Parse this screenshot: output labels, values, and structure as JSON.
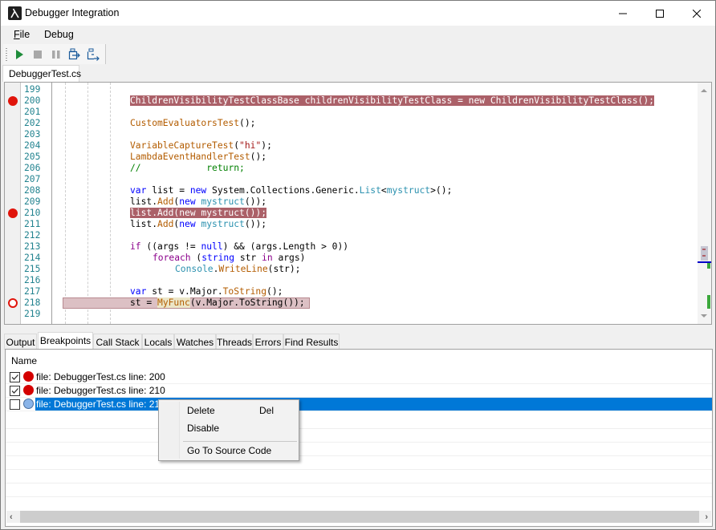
{
  "window": {
    "title": "Debugger Integration",
    "controls": {
      "minimize": "minimize",
      "maximize": "maximize",
      "close": "close"
    }
  },
  "menu": {
    "items": [
      {
        "label_underlined": "F",
        "label_rest": "ile"
      },
      {
        "label": "Debug"
      }
    ]
  },
  "toolbar": {
    "buttons": [
      "play",
      "stop",
      "pause",
      "step-into",
      "step-over"
    ]
  },
  "document_tab": {
    "label": "DebuggerTest.cs"
  },
  "editor": {
    "lines": [
      {
        "num": "199"
      },
      {
        "num": "200",
        "breakpoint": "enabled",
        "highlight": "active"
      },
      {
        "num": "201"
      },
      {
        "num": "202"
      },
      {
        "num": "203"
      },
      {
        "num": "204"
      },
      {
        "num": "205"
      },
      {
        "num": "206"
      },
      {
        "num": "207"
      },
      {
        "num": "208"
      },
      {
        "num": "209"
      },
      {
        "num": "210",
        "breakpoint": "enabled",
        "highlight": "active"
      },
      {
        "num": "211"
      },
      {
        "num": "212"
      },
      {
        "num": "213"
      },
      {
        "num": "214"
      },
      {
        "num": "215"
      },
      {
        "num": "216"
      },
      {
        "num": "217"
      },
      {
        "num": "218",
        "breakpoint": "disabled",
        "highlight": "disabled"
      },
      {
        "num": "219"
      }
    ],
    "code": {
      "l200": "ChildrenVisibilityTestClassBase childrenVisibilityTestClass = new ChildrenVisibilityTestClass();",
      "l202_fn": "CustomEvaluatorsTest",
      "l202_rest": "();",
      "l204_fn": "VariableCaptureTest",
      "l204_p1": "(",
      "l204_str": "\"hi\"",
      "l204_p2": ");",
      "l205_fn": "LambdaEventHandlerTest",
      "l205_rest": "();",
      "l206_c1": "//",
      "l206_c2": "return;",
      "l208_var": "var",
      "l208_a": " list = ",
      "l208_new": "new",
      "l208_b": " System.Collections.Generic.",
      "l208_list": "List",
      "l208_lt": "<",
      "l208_my": "mystruct",
      "l208_c": ">();",
      "l209_a": "list.",
      "l209_add": "Add",
      "l209_b": "(",
      "l209_new": "new",
      "l209_sp": " ",
      "l209_my": "mystruct",
      "l209_c": "());",
      "l210": "list.Add(new mystruct());",
      "l213_if": "if",
      "l213_a": " ((args != ",
      "l213_null": "null",
      "l213_b": ") && (args.Length > 0))",
      "l214_fe": "foreach",
      "l214_a": " (",
      "l214_str": "string",
      "l214_b": " str ",
      "l214_in": "in",
      "l214_c": " args)",
      "l215_con": "Console",
      "l215_dot": ".",
      "l215_wl": "WriteLine",
      "l215_rest": "(str);",
      "l217_var": "var",
      "l217_a": " st = v.Major.",
      "l217_ts": "ToString",
      "l217_b": "();",
      "l218_a": "st = ",
      "l218_fn": "MyFunc",
      "l218_b": "(v.Major.ToString());"
    }
  },
  "tool_tabs": [
    {
      "label": "Output",
      "active": false
    },
    {
      "label": "Breakpoints",
      "active": true
    },
    {
      "label": "Call Stack",
      "active": false
    },
    {
      "label": "Locals",
      "active": false
    },
    {
      "label": "Watches",
      "active": false
    },
    {
      "label": "Threads",
      "active": false
    },
    {
      "label": "Errors",
      "active": false
    },
    {
      "label": "Find Results",
      "active": false
    }
  ],
  "breakpoints": {
    "column_header": "Name",
    "rows": [
      {
        "checked": true,
        "enabled": true,
        "label": "file: DebuggerTest.cs line: 200"
      },
      {
        "checked": true,
        "enabled": true,
        "label": "file: DebuggerTest.cs line: 210"
      },
      {
        "checked": false,
        "enabled": false,
        "selected": true,
        "label": "file: DebuggerTest.cs line: 218"
      }
    ]
  },
  "context_menu": {
    "items": [
      {
        "label": "Delete",
        "shortcut": "Del"
      },
      {
        "label": "Disable",
        "shortcut": ""
      },
      {
        "label": "Go To Source Code",
        "shortcut": ""
      }
    ]
  },
  "colors": {
    "active_breakpoint_line": "#ab6068",
    "disabled_breakpoint_line": "#dcc0c4",
    "breakpoint_dot": "#e0140b",
    "selection": "#0078d7",
    "line_number": "#22838f"
  }
}
